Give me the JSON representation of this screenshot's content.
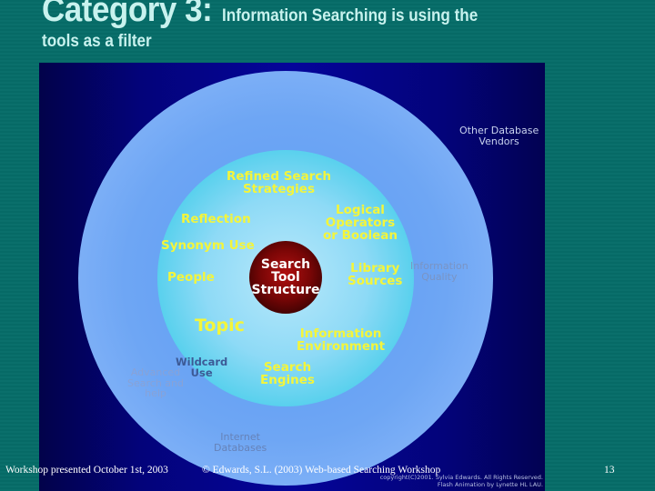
{
  "slide": {
    "title_large": "Category 3:",
    "title_small": "Information Searching is using the",
    "title_line2": "tools as a filter",
    "background_color": "#066a66",
    "title_color": "#c8f2ee"
  },
  "diagram": {
    "layers": [
      {
        "name": "outer-ring",
        "color": "#7eb0f6"
      },
      {
        "name": "inner-ring",
        "color": "#46cdea"
      },
      {
        "name": "core",
        "color": "#7a0606"
      }
    ],
    "core_label": [
      "Search",
      "Tool",
      "Structure"
    ],
    "inner_labels": {
      "refined_search": [
        "Refined Search",
        "Strategies"
      ],
      "reflection": "Reflection",
      "logical_operators": [
        "Logical",
        "Operators",
        "or Boolean"
      ],
      "synonym_use": "Synonym Use",
      "people": "People",
      "library_sources": [
        "Library",
        "Sources"
      ],
      "topic": "Topic",
      "information_environment": [
        "Information",
        "Environment"
      ],
      "search_engines": [
        "Search",
        "Engines"
      ]
    },
    "outer_labels": {
      "information_quality": [
        "Information",
        "Quality"
      ],
      "wildcard_use": [
        "Wildcard",
        "Use"
      ],
      "advanced_search": [
        "Advanced",
        "Search and",
        "help"
      ],
      "internet_databases": [
        "Internet",
        "Databases"
      ]
    },
    "background_labels": {
      "other_database_vendors": [
        "Other Database",
        "Vendors"
      ]
    },
    "credits": [
      "copyright(C)2001. Sylvia Edwards. All Rights Reserved.",
      "Flash Animation by Lynette HL LAU."
    ],
    "label_color": "#f4f53a"
  },
  "footer": {
    "left": "Workshop presented October 1st, 2003",
    "center": "© Edwards, S.L. (2003) Web-based Searching Workshop",
    "page_number": "13"
  }
}
